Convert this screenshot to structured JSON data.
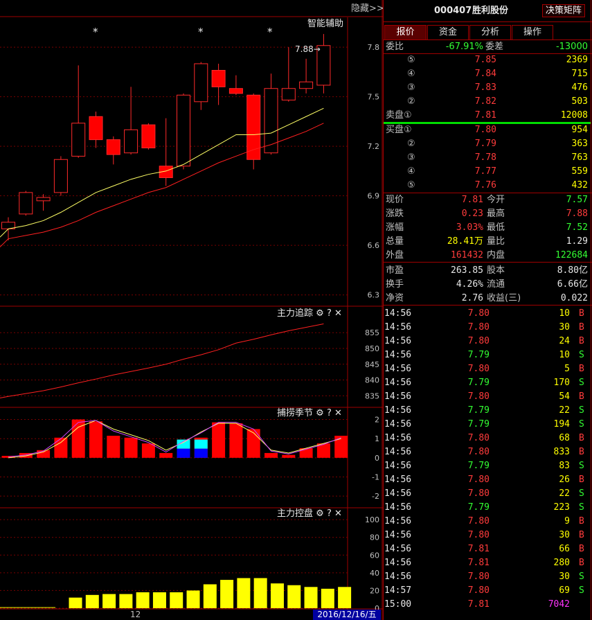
{
  "header": {
    "hide_label": "隐藏>>",
    "stock_code": "000407",
    "stock_name": "胜利股份",
    "decision_button": "决策矩阵",
    "smart_assist": "智能辅助"
  },
  "tabs": [
    "报价",
    "资金",
    "分析",
    "操作"
  ],
  "quote": {
    "weibi_label": "委比",
    "weibi_value": "-67.91%",
    "weicha_label": "委差",
    "weicha_value": "-13000",
    "sell": [
      {
        "label": "⑤",
        "price": "7.85",
        "vol": "2369"
      },
      {
        "label": "④",
        "price": "7.84",
        "vol": "715"
      },
      {
        "label": "③",
        "price": "7.83",
        "vol": "476"
      },
      {
        "label": "②",
        "price": "7.82",
        "vol": "503"
      },
      {
        "label": "卖盘①",
        "price": "7.81",
        "vol": "12008"
      }
    ],
    "buy": [
      {
        "label": "买盘①",
        "price": "7.80",
        "vol": "954"
      },
      {
        "label": "②",
        "price": "7.79",
        "vol": "363"
      },
      {
        "label": "③",
        "price": "7.78",
        "vol": "763"
      },
      {
        "label": "④",
        "price": "7.77",
        "vol": "559"
      },
      {
        "label": "⑤",
        "price": "7.76",
        "vol": "432"
      }
    ],
    "stats": [
      {
        "l1": "现价",
        "v1": "7.81",
        "c1": "red",
        "l2": "今开",
        "v2": "7.57",
        "c2": "green"
      },
      {
        "l1": "涨跌",
        "v1": "0.23",
        "c1": "red",
        "l2": "最高",
        "v2": "7.88",
        "c2": "red"
      },
      {
        "l1": "涨幅",
        "v1": "3.03%",
        "c1": "red",
        "l2": "最低",
        "v2": "7.52",
        "c2": "green"
      },
      {
        "l1": "总量",
        "v1": "28.41万",
        "c1": "yellow",
        "l2": "量比",
        "v2": "1.29",
        "c2": "white"
      },
      {
        "l1": "外盘",
        "v1": "161432",
        "c1": "red",
        "l2": "内盘",
        "v2": "122684",
        "c2": "green"
      },
      {
        "l1": "市盈",
        "v1": "263.85",
        "c1": "white",
        "l2": "股本",
        "v2": "8.80亿",
        "c2": "white"
      },
      {
        "l1": "换手",
        "v1": "4.26%",
        "c1": "white",
        "l2": "流通",
        "v2": "6.66亿",
        "c2": "white"
      },
      {
        "l1": "净资",
        "v1": "2.76",
        "c1": "white",
        "l2": "收益(三)",
        "v2": "0.022",
        "c2": "white"
      }
    ]
  },
  "trades": [
    {
      "time": "14:56",
      "price": "7.80",
      "vol": "10",
      "side": "B"
    },
    {
      "time": "14:56",
      "price": "7.80",
      "vol": "30",
      "side": "B"
    },
    {
      "time": "14:56",
      "price": "7.80",
      "vol": "24",
      "side": "B"
    },
    {
      "time": "14:56",
      "price": "7.79",
      "vol": "10",
      "side": "S"
    },
    {
      "time": "14:56",
      "price": "7.80",
      "vol": "5",
      "side": "B"
    },
    {
      "time": "14:56",
      "price": "7.79",
      "vol": "170",
      "side": "S"
    },
    {
      "time": "14:56",
      "price": "7.80",
      "vol": "54",
      "side": "B"
    },
    {
      "time": "14:56",
      "price": "7.79",
      "vol": "22",
      "side": "S"
    },
    {
      "time": "14:56",
      "price": "7.79",
      "vol": "194",
      "side": "S"
    },
    {
      "time": "14:56",
      "price": "7.80",
      "vol": "68",
      "side": "B"
    },
    {
      "time": "14:56",
      "price": "7.80",
      "vol": "833",
      "side": "B"
    },
    {
      "time": "14:56",
      "price": "7.79",
      "vol": "83",
      "side": "S"
    },
    {
      "time": "14:56",
      "price": "7.80",
      "vol": "26",
      "side": "B"
    },
    {
      "time": "14:56",
      "price": "7.80",
      "vol": "22",
      "side": "S"
    },
    {
      "time": "14:56",
      "price": "7.79",
      "vol": "223",
      "side": "S"
    },
    {
      "time": "14:56",
      "price": "7.80",
      "vol": "9",
      "side": "B"
    },
    {
      "time": "14:56",
      "price": "7.80",
      "vol": "30",
      "side": "B"
    },
    {
      "time": "14:56",
      "price": "7.81",
      "vol": "66",
      "side": "B"
    },
    {
      "time": "14:56",
      "price": "7.81",
      "vol": "280",
      "side": "B"
    },
    {
      "time": "14:56",
      "price": "7.80",
      "vol": "30",
      "side": "S"
    },
    {
      "time": "14:57",
      "price": "7.80",
      "vol": "69",
      "side": "S"
    },
    {
      "time": "15:00",
      "price": "7.81",
      "vol": "7042",
      "side": ""
    }
  ],
  "chart_data": [
    {
      "type": "candlestick",
      "name": "price",
      "yticks": [
        "7.8",
        "7.5",
        "7.2",
        "6.9",
        "6.6",
        "6.3"
      ],
      "ylim": [
        6.24,
        7.96
      ],
      "high_annotation": "7.88→",
      "candles": [
        {
          "o": 6.7,
          "c": 6.74,
          "h": 6.77,
          "l": 6.63
        },
        {
          "o": 6.79,
          "c": 6.92,
          "h": 6.93,
          "l": 6.78
        },
        {
          "o": 6.87,
          "c": 6.89,
          "h": 6.91,
          "l": 6.81
        },
        {
          "o": 6.92,
          "c": 7.12,
          "h": 7.14,
          "l": 6.9
        },
        {
          "o": 7.14,
          "c": 7.34,
          "h": 7.69,
          "l": 7.13
        },
        {
          "o": 7.38,
          "c": 7.24,
          "h": 7.41,
          "l": 7.19
        },
        {
          "o": 7.24,
          "c": 7.15,
          "h": 7.26,
          "l": 7.09
        },
        {
          "o": 7.16,
          "c": 7.3,
          "h": 7.56,
          "l": 7.15
        },
        {
          "o": 7.33,
          "c": 7.19,
          "h": 7.34,
          "l": 7.18
        },
        {
          "o": 7.08,
          "c": 7.01,
          "h": 7.37,
          "l": 6.96
        },
        {
          "o": 7.08,
          "c": 7.51,
          "h": 7.52,
          "l": 7.06
        },
        {
          "o": 7.47,
          "c": 7.7,
          "h": 7.71,
          "l": 7.42
        },
        {
          "o": 7.66,
          "c": 7.56,
          "h": 7.7,
          "l": 7.45
        },
        {
          "o": 7.55,
          "c": 7.52,
          "h": 7.63,
          "l": 7.51
        },
        {
          "o": 7.51,
          "c": 7.12,
          "h": 7.52,
          "l": 7.06
        },
        {
          "o": 7.16,
          "c": 7.55,
          "h": 7.64,
          "l": 7.15
        },
        {
          "o": 7.48,
          "c": 7.55,
          "h": 7.8,
          "l": 7.47
        },
        {
          "o": 7.55,
          "c": 7.59,
          "h": 7.73,
          "l": 7.52
        },
        {
          "o": 7.57,
          "c": 7.81,
          "h": 7.88,
          "l": 7.52
        }
      ],
      "ma_yellow": [
        6.7,
        6.72,
        6.75,
        6.8,
        6.86,
        6.92,
        6.96,
        7.0,
        7.03,
        7.05,
        7.09,
        7.15,
        7.21,
        7.27,
        7.27,
        7.28,
        7.33,
        7.38,
        7.43
      ],
      "ma_red": [
        6.64,
        6.66,
        6.68,
        6.71,
        6.75,
        6.8,
        6.84,
        6.88,
        6.92,
        6.95,
        7.0,
        7.05,
        7.1,
        7.14,
        7.18,
        7.21,
        7.25,
        7.29,
        7.34
      ]
    },
    {
      "type": "line",
      "name": "主力追踪",
      "yticks": [
        "855",
        "850",
        "845",
        "840",
        "835"
      ],
      "ylim": [
        832,
        859
      ],
      "values": [
        834.8,
        835.7,
        836.6,
        837.8,
        839.1,
        840.3,
        841.6,
        842.7,
        843.8,
        845.0,
        846.6,
        848.0,
        849.6,
        851.7,
        852.9,
        854.3,
        855.6,
        856.7,
        857.8
      ]
    },
    {
      "type": "bar",
      "name": "捕捞季节",
      "yticks": [
        "2",
        "1",
        "0",
        "-1",
        "-2"
      ],
      "ylim": [
        -2.5,
        2.2
      ],
      "values": [
        0.1,
        0.25,
        0.4,
        1.05,
        2.0,
        1.9,
        1.15,
        1.05,
        0.75,
        0.25,
        0.95,
        1.05,
        1.85,
        1.8,
        1.5,
        0.25,
        0.15,
        0.5,
        0.75,
        1.15
      ],
      "cyan_values": [
        0,
        0,
        0,
        0,
        0,
        0,
        0,
        0,
        0,
        0,
        0.95,
        0.95,
        0,
        0,
        0,
        0,
        0,
        0,
        0,
        0
      ],
      "line_yellow": [
        0.0,
        0.1,
        0.3,
        0.8,
        1.6,
        1.95,
        1.5,
        1.2,
        0.9,
        0.4,
        0.8,
        1.35,
        1.8,
        1.8,
        1.3,
        0.4,
        0.25,
        0.5,
        0.75,
        1.0
      ],
      "line_purple": [
        0.05,
        0.15,
        0.35,
        1.0,
        1.85,
        1.95,
        1.4,
        1.1,
        0.8,
        0.3,
        0.85,
        1.3,
        1.85,
        1.85,
        1.5,
        0.35,
        0.2,
        0.45,
        0.7,
        1.05
      ]
    },
    {
      "type": "bar",
      "name": "主力控盘",
      "yticks": [
        "100",
        "80",
        "60",
        "40",
        "20",
        "0"
      ],
      "ylim": [
        0,
        104
      ],
      "values": [
        0,
        0,
        0,
        0,
        12,
        15,
        16,
        16,
        18,
        18,
        18,
        20,
        27,
        32,
        34,
        34,
        28,
        26,
        24,
        22,
        24
      ]
    }
  ],
  "axis": {
    "x_label": "12",
    "date_label": "2016/12/16/五"
  },
  "asterisks": [
    "*",
    "*",
    "*"
  ]
}
